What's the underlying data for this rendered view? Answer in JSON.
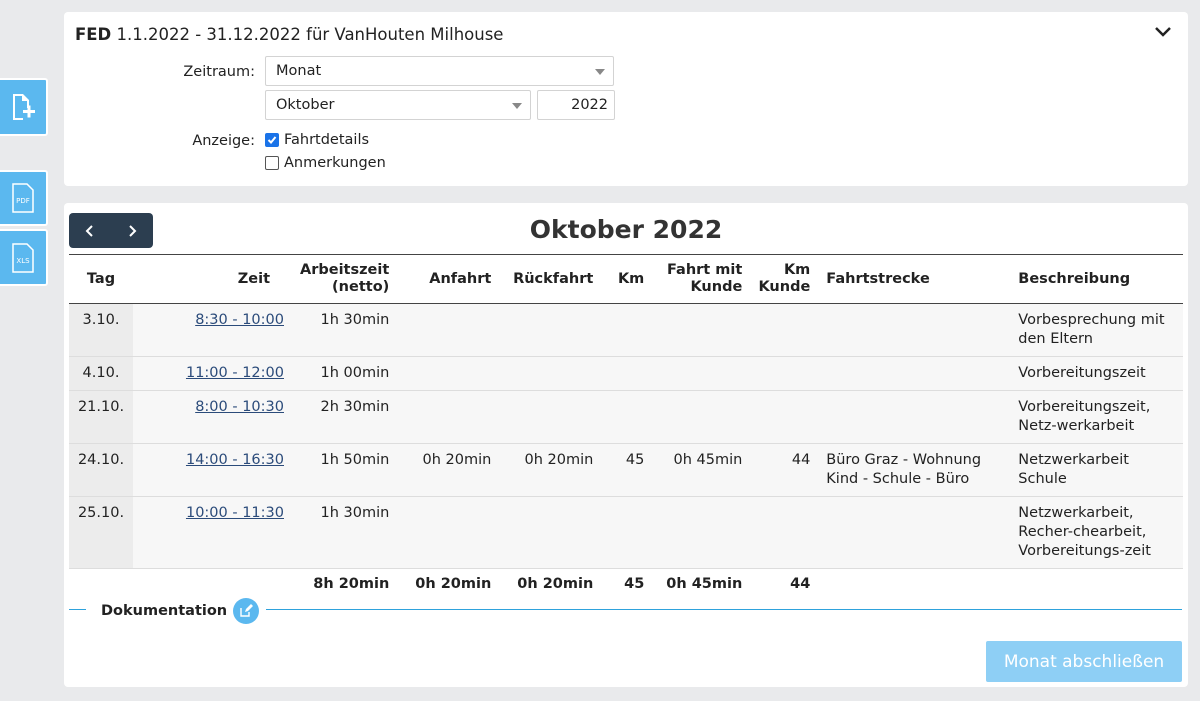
{
  "filter": {
    "prefix": "FED",
    "title": "1.1.2022 - 31.12.2022 für VanHouten Milhouse",
    "zeitraum_label": "Zeitraum:",
    "zeitraum_value": "Monat",
    "month_value": "Oktober",
    "year_value": "2022",
    "anzeige_label": "Anzeige:",
    "options": [
      {
        "label": "Fahrtdetails",
        "checked": true
      },
      {
        "label": "Anmerkungen",
        "checked": false
      }
    ]
  },
  "sidebar": {
    "add_icon": "add-document-icon",
    "pdf_label": "PDF",
    "xls_label": "XLS"
  },
  "report": {
    "month_title": "Oktober 2022",
    "headers": {
      "tag": "Tag",
      "zeit": "Zeit",
      "arbeitszeit_1": "Arbeitszeit",
      "arbeitszeit_2": "(netto)",
      "anfahrt": "Anfahrt",
      "rueckfahrt": "Rückfahrt",
      "km": "Km",
      "fahrt_mit_kunde_1": "Fahrt mit",
      "fahrt_mit_kunde_2": "Kunde",
      "km_kunde_1": "Km",
      "km_kunde_2": "Kunde",
      "fahrtstrecke": "Fahrtstrecke",
      "beschreibung": "Beschreibung"
    },
    "rows": [
      {
        "tag": "3.10.",
        "zeit": "8:30 - 10:00",
        "arbeitszeit": "1h 30min",
        "anfahrt": "",
        "rueckfahrt": "",
        "km": "",
        "fahrt_mit_kunde": "",
        "km_kunde": "",
        "fahrtstrecke": "",
        "beschreibung": "Vorbesprechung mit den Eltern"
      },
      {
        "tag": "4.10.",
        "zeit": "11:00 - 12:00",
        "arbeitszeit": "1h 00min",
        "anfahrt": "",
        "rueckfahrt": "",
        "km": "",
        "fahrt_mit_kunde": "",
        "km_kunde": "",
        "fahrtstrecke": "",
        "beschreibung": "Vorbereitungszeit"
      },
      {
        "tag": "21.10.",
        "zeit": "8:00 - 10:30",
        "arbeitszeit": "2h 30min",
        "anfahrt": "",
        "rueckfahrt": "",
        "km": "",
        "fahrt_mit_kunde": "",
        "km_kunde": "",
        "fahrtstrecke": "",
        "beschreibung": "Vorbereitungszeit, Netz-werkarbeit"
      },
      {
        "tag": "24.10.",
        "zeit": "14:00 - 16:30",
        "arbeitszeit": "1h 50min",
        "anfahrt": "0h 20min",
        "rueckfahrt": "0h 20min",
        "km": "45",
        "fahrt_mit_kunde": "0h 45min",
        "km_kunde": "44",
        "fahrtstrecke": "Büro Graz - Wohnung Kind - Schule - Büro",
        "beschreibung": "Netzwerkarbeit Schule"
      },
      {
        "tag": "25.10.",
        "zeit": "10:00 - 11:30",
        "arbeitszeit": "1h 30min",
        "anfahrt": "",
        "rueckfahrt": "",
        "km": "",
        "fahrt_mit_kunde": "",
        "km_kunde": "",
        "fahrtstrecke": "",
        "beschreibung": "Netzwerkarbeit, Recher-chearbeit, Vorbereitungs-zeit"
      }
    ],
    "totals": {
      "arbeitszeit": "8h 20min",
      "anfahrt": "0h 20min",
      "rueckfahrt": "0h 20min",
      "km": "45",
      "fahrt_mit_kunde": "0h 45min",
      "km_kunde": "44"
    },
    "documentation_label": "Dokumentation",
    "close_button": "Monat abschließen"
  },
  "colors": {
    "accent": "#5bb8ef",
    "nav_dark": "#2c3e50",
    "doc_line": "#2ea2dc",
    "button_disabled": "#8ecff5"
  }
}
